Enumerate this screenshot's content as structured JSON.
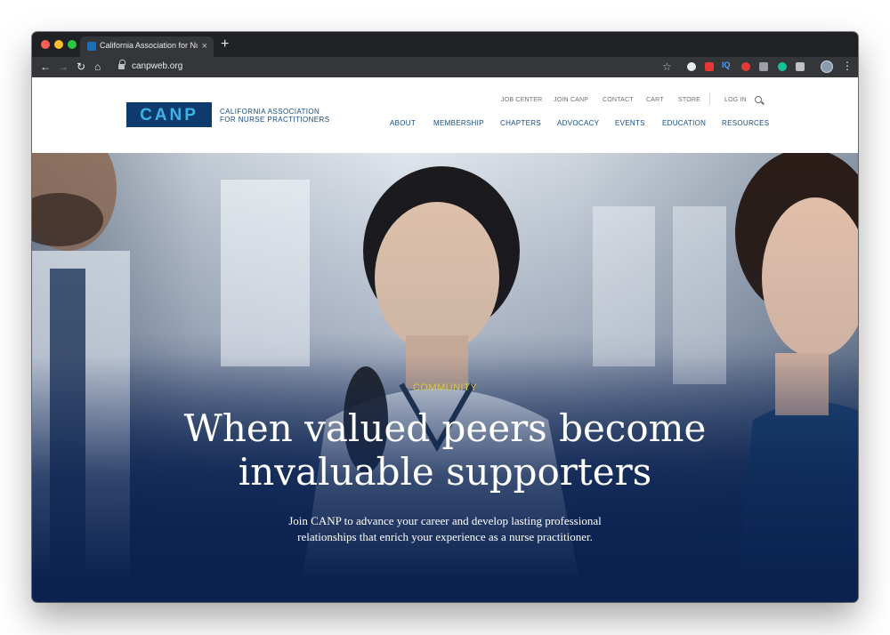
{
  "browser": {
    "tab_title": "California Association for Nurse Practitioners",
    "tab_close": "×",
    "new_tab": "+",
    "url": "canpweb.org",
    "nav": {
      "back": "←",
      "forward": "→",
      "reload": "↻",
      "home": "⌂"
    },
    "star": "☆",
    "extensions": [
      "circle-extension-icon",
      "record-extension-icon",
      "IQ",
      "notification-extension-icon",
      "key-extension-icon",
      "grammarly-extension-icon",
      "camera-extension-icon"
    ],
    "extension_iq_label": "IQ",
    "menu": "⋮"
  },
  "site": {
    "logo_wordmark": "CANP",
    "logo_text_line1": "CALIFORNIA ASSOCIATION",
    "logo_text_line2": "FOR NURSE PRACTITIONERS",
    "utility_nav": [
      "JOB CENTER",
      "JOIN CANP",
      "CONTACT",
      "CART",
      "STORE"
    ],
    "login": "LOG IN",
    "main_nav": [
      "ABOUT",
      "MEMBERSHIP",
      "CHAPTERS",
      "ADVOCACY",
      "EVENTS",
      "EDUCATION",
      "RESOURCES"
    ]
  },
  "hero": {
    "label": "COMMUNITY",
    "title_line1": "When valued peers become",
    "title_line2": "invaluable supporters",
    "body_line1": "Join CANP to advance your career and develop lasting professional",
    "body_line2": "relationships that enrich your experience as a nurse practitioner."
  },
  "colors": {
    "brand_navy": "#0f3a6e",
    "brand_blue": "#3cb2e6",
    "hero_accent": "#d9c64a",
    "hero_bottom": "#0b2250"
  }
}
